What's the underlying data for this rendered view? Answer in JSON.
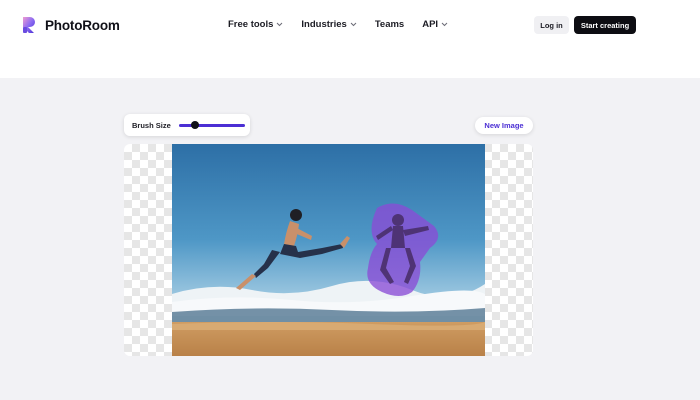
{
  "brand": {
    "name": "PhotoRoom",
    "accent": "#4b2fd4"
  },
  "nav": {
    "items": [
      {
        "label": "Free tools",
        "dropdown": true
      },
      {
        "label": "Industries",
        "dropdown": true
      },
      {
        "label": "Teams",
        "dropdown": false
      },
      {
        "label": "API",
        "dropdown": true
      }
    ]
  },
  "header_actions": {
    "login_label": "Log in",
    "start_label": "Start creating"
  },
  "editor": {
    "brush_label": "Brush Size",
    "brush_level": 0.25,
    "new_image_label": "New Image"
  },
  "icons": [
    "photoroom-logo-icon",
    "chevron-down-icon"
  ],
  "colors": {
    "primary_button": "#0d0d12",
    "slider_track": "#4b2fd4",
    "brush_overlay": "#8a4bd6"
  }
}
